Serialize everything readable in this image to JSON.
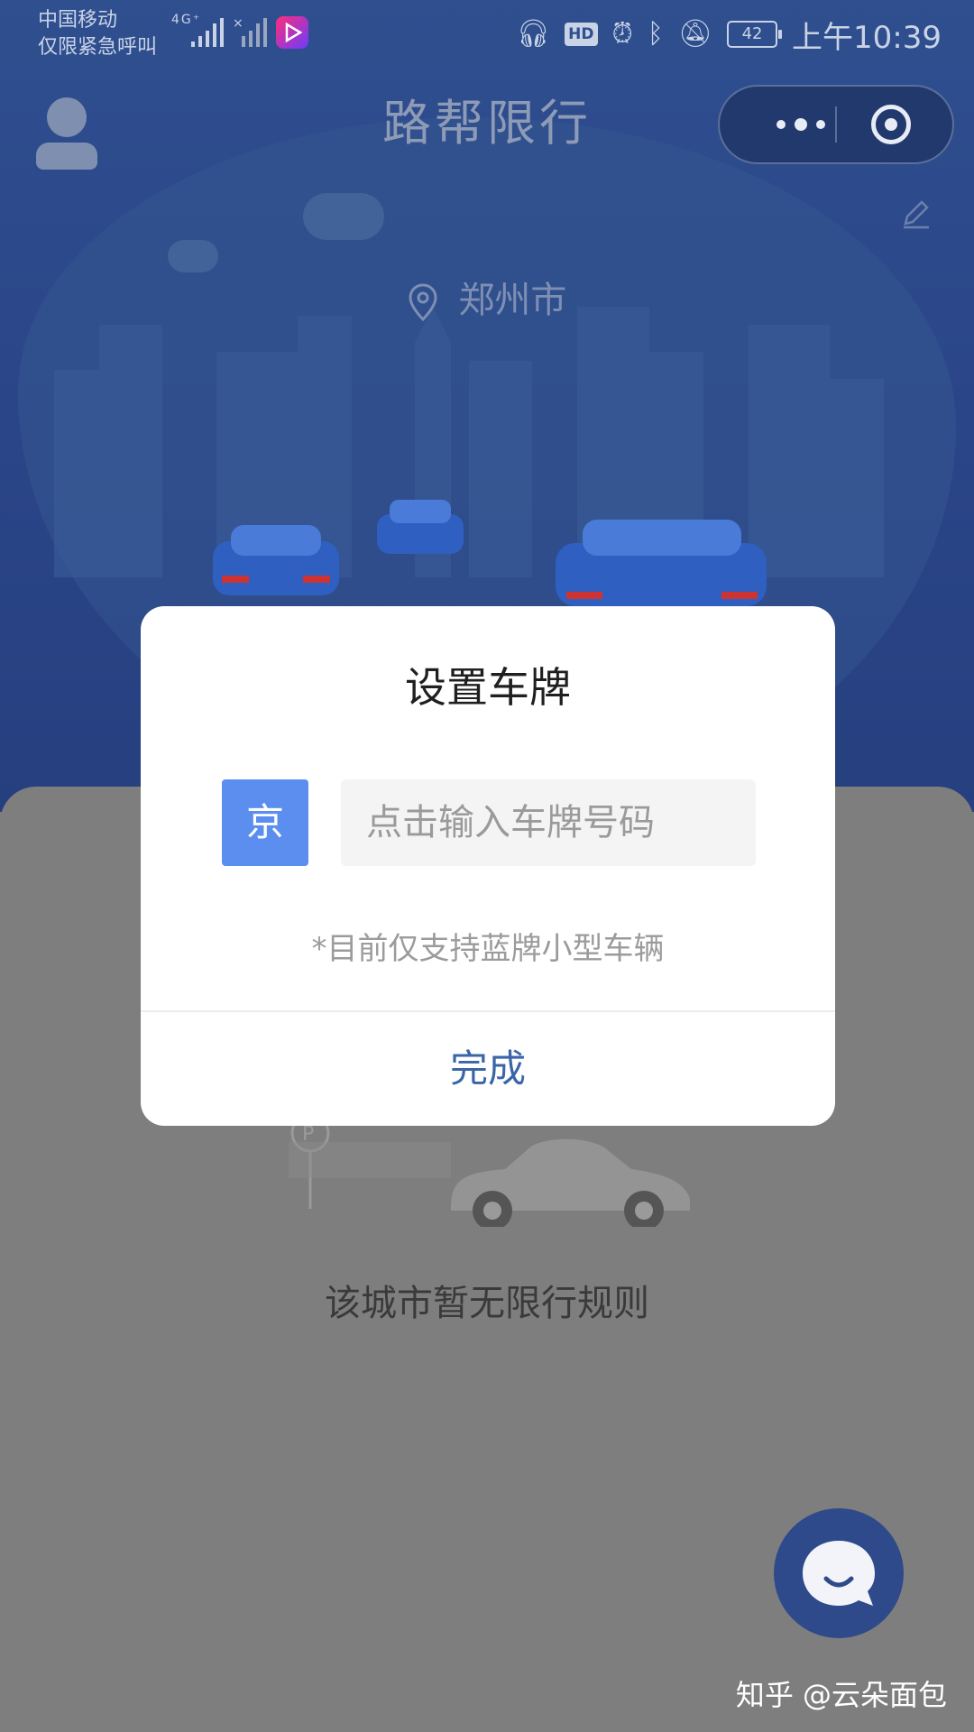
{
  "status_bar": {
    "carrier_line1": "中国移动",
    "carrier_line2": "仅限紧急呼叫",
    "network": "4G⁺",
    "battery": "42",
    "hd": "HD",
    "time": "上午10:39"
  },
  "titlebar": {
    "title": "路帮限行"
  },
  "header": {
    "city": "郑州市"
  },
  "main": {
    "empty_text": "该城市暂无限行规则"
  },
  "modal": {
    "title": "设置车牌",
    "province": "京",
    "plate_placeholder": "点击输入车牌号码",
    "plate_value": "",
    "hint": "*目前仅支持蓝牌小型车辆",
    "done_label": "完成"
  },
  "watermark": "知乎 @云朵面包",
  "colors": {
    "header_blue": "#2f4f8f",
    "province_blue": "#5c8ef0",
    "done_text": "#3a65a8",
    "overlay_gray": "#7e7e7e"
  }
}
